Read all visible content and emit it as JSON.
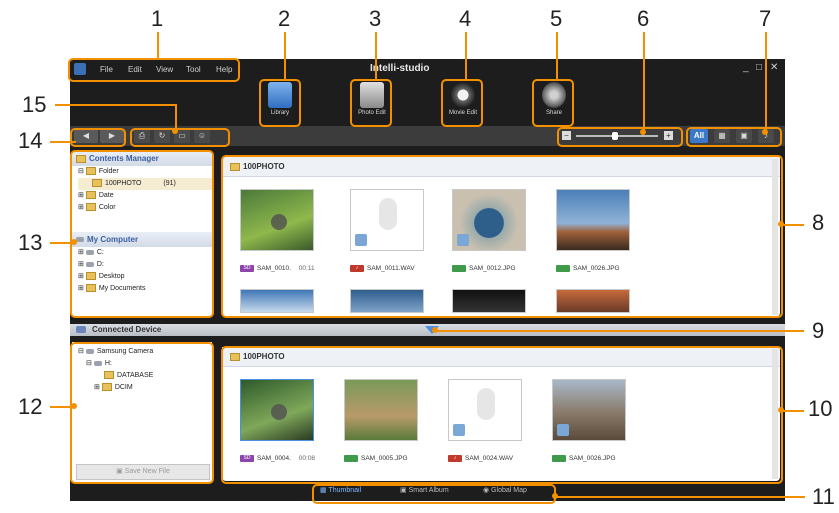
{
  "app": {
    "title": "Intelli-studio",
    "menu": [
      "File",
      "Edit",
      "View",
      "Tool",
      "Help"
    ],
    "modes": [
      {
        "label": "Library",
        "icon": "library-icon"
      },
      {
        "label": "Photo Edit",
        "icon": "photo-edit-icon"
      },
      {
        "label": "Movie Edit",
        "icon": "movie-edit-icon"
      },
      {
        "label": "Share",
        "icon": "share-icon"
      }
    ],
    "view_all": "All",
    "sidebar": {
      "contents_manager": "Contents Manager",
      "tree": [
        {
          "label": "Folder"
        },
        {
          "label": "100PHOTO",
          "count": "(91)"
        },
        {
          "label": "Date"
        },
        {
          "label": "Color"
        }
      ],
      "my_computer": "My Computer",
      "computer_tree": [
        "C:",
        "D:",
        "Desktop",
        "My Documents"
      ]
    },
    "top_gallery": {
      "folder": "100PHOTO",
      "items": [
        {
          "badge": "SD",
          "name": "SAM_0010.",
          "duration": "00:11"
        },
        {
          "badge": "",
          "name": "SAM_0011.WAV",
          "duration": ""
        },
        {
          "badge": "",
          "name": "SAM_0012.JPG",
          "duration": ""
        },
        {
          "badge": "",
          "name": "SAM_0026.JPG",
          "duration": ""
        }
      ]
    },
    "connected_device": "Connected Device",
    "device_tree": [
      "Samsung Camera",
      "H:",
      "DATABASE",
      "DCIM"
    ],
    "save_new_file": "Save New File",
    "bottom_gallery": {
      "folder": "100PHOTO",
      "items": [
        {
          "badge": "SD",
          "name": "SAM_0004.",
          "duration": "00:08"
        },
        {
          "badge": "",
          "name": "SAM_0005.JPG",
          "duration": ""
        },
        {
          "badge": "",
          "name": "SAM_0024.WAV",
          "duration": ""
        },
        {
          "badge": "",
          "name": "SAM_0026.JPG",
          "duration": ""
        }
      ]
    },
    "bottom_tabs": [
      "Thumbnail",
      "Smart Album",
      "Global Map"
    ]
  },
  "callouts": [
    "1",
    "2",
    "3",
    "4",
    "5",
    "6",
    "7",
    "8",
    "9",
    "10",
    "11",
    "12",
    "13",
    "14",
    "15"
  ],
  "colors": {
    "accent": "#f39000",
    "app_bg": "#1d1d1d",
    "header_blue": "#3a5fa0"
  }
}
